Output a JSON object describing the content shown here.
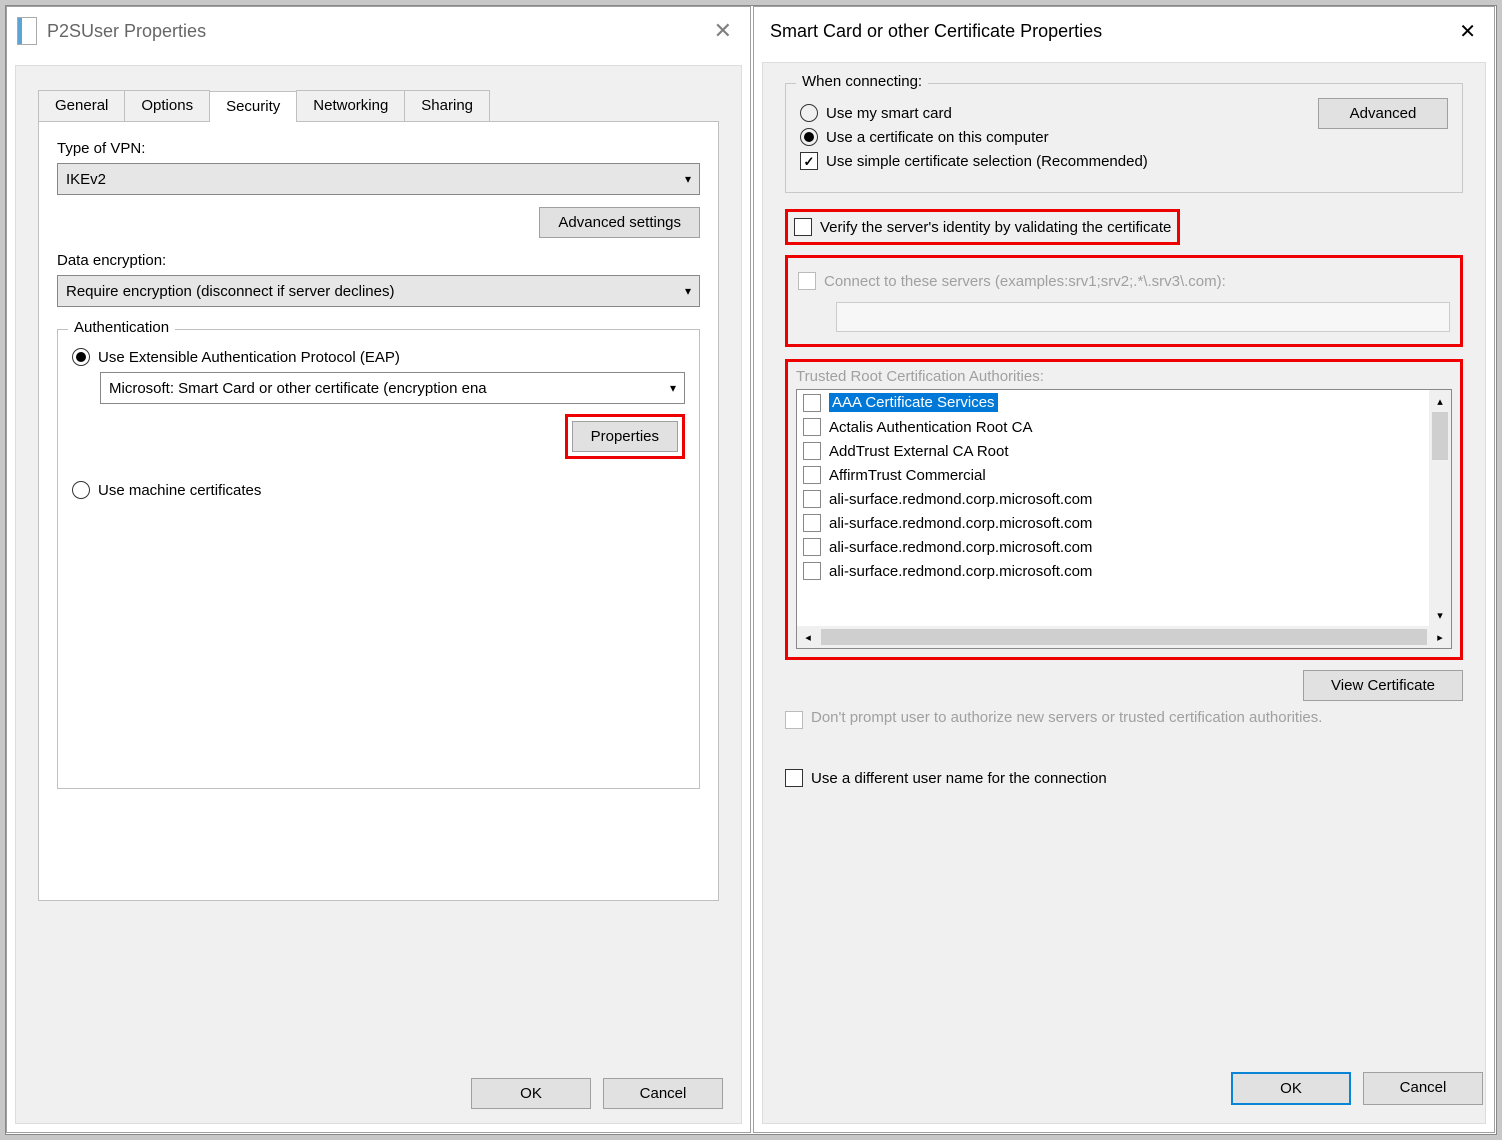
{
  "left": {
    "title": "P2SUser Properties",
    "tabs": [
      "General",
      "Options",
      "Security",
      "Networking",
      "Sharing"
    ],
    "active_tab_index": 2,
    "vpn_type_label": "Type of VPN:",
    "vpn_type_value": "IKEv2",
    "advanced_settings": "Advanced settings",
    "data_encryption_label": "Data encryption:",
    "data_encryption_value": "Require encryption (disconnect if server declines)",
    "auth_legend": "Authentication",
    "eap_radio": "Use Extensible Authentication Protocol (EAP)",
    "eap_method": "Microsoft: Smart Card or other certificate (encryption ena",
    "properties_btn": "Properties",
    "machine_cert_radio": "Use machine certificates",
    "ok": "OK",
    "cancel": "Cancel"
  },
  "right": {
    "title": "Smart Card or other Certificate Properties",
    "when_connecting": "When connecting:",
    "use_smart_card": "Use my smart card",
    "use_cert": "Use a certificate on this computer",
    "simple_sel": "Use simple certificate selection (Recommended)",
    "advanced_btn": "Advanced",
    "verify_identity": "Verify the server's identity by validating the certificate",
    "connect_servers": "Connect to these servers (examples:srv1;srv2;.*\\.srv3\\.com):",
    "trusted_root_label": "Trusted Root Certification Authorities:",
    "cert_list": [
      "AAA Certificate Services",
      "Actalis Authentication Root CA",
      "AddTrust External CA Root",
      "AffirmTrust Commercial",
      "ali-surface.redmond.corp.microsoft.com",
      "ali-surface.redmond.corp.microsoft.com",
      "ali-surface.redmond.corp.microsoft.com",
      "ali-surface.redmond.corp.microsoft.com"
    ],
    "view_cert": "View Certificate",
    "dont_prompt": "Don't prompt user to authorize new servers or trusted certification authorities.",
    "diff_user": "Use a different user name for the connection",
    "ok": "OK",
    "cancel": "Cancel"
  }
}
